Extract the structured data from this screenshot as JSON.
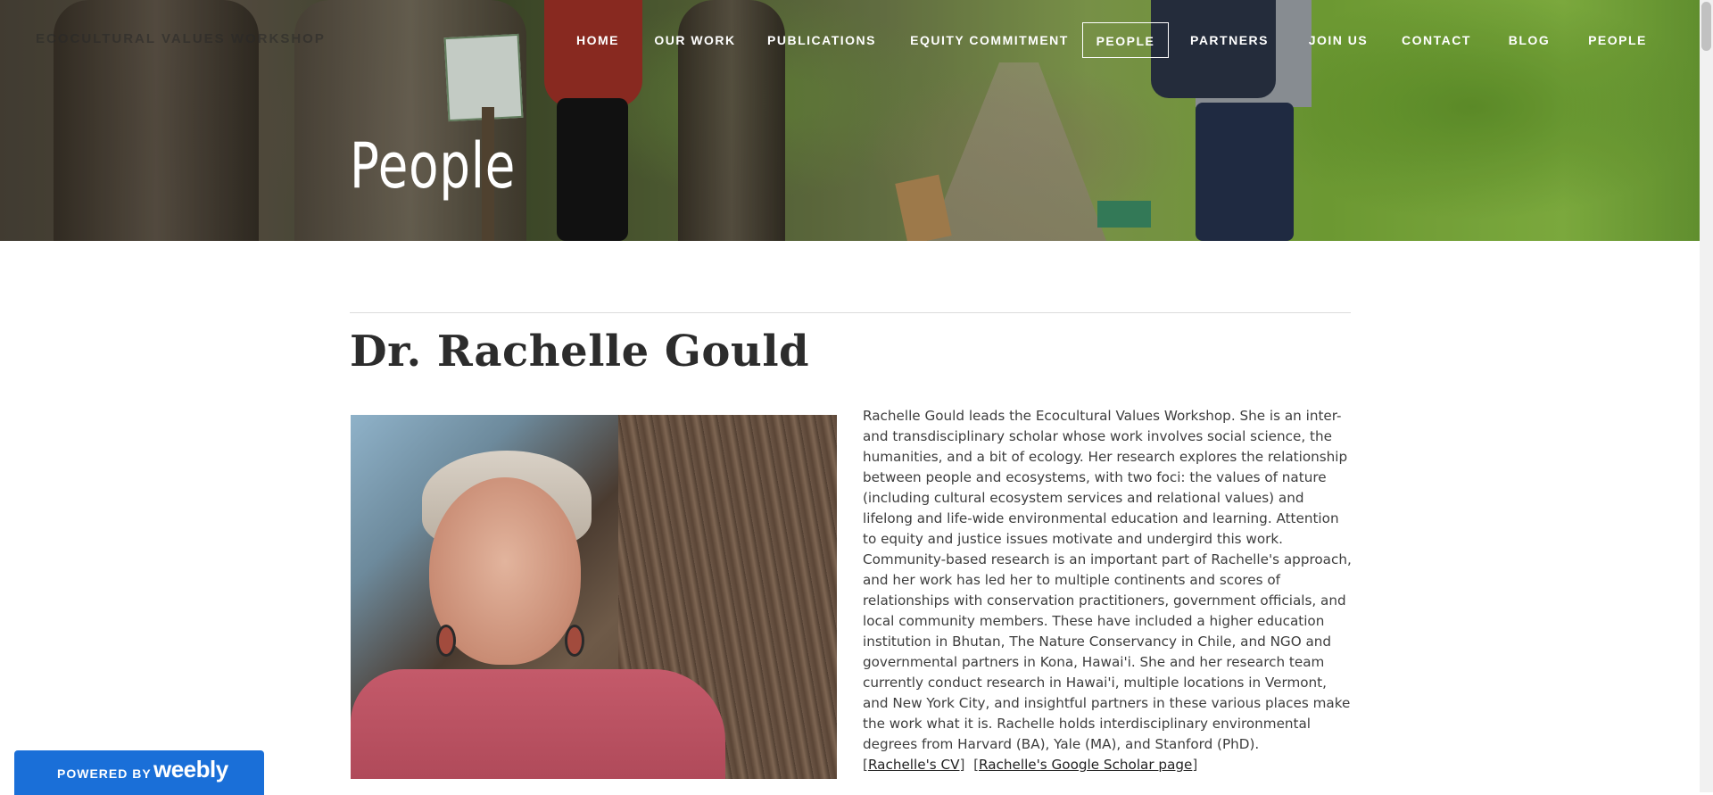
{
  "site": {
    "title": "ECOCULTURAL VALUES WORKSHOP"
  },
  "nav": {
    "items": [
      {
        "label": "HOME"
      },
      {
        "label": "OUR WORK"
      },
      {
        "label": "PUBLICATIONS"
      },
      {
        "label": "EQUITY COMMITMENT"
      },
      {
        "label": "PEOPLE",
        "active": true
      },
      {
        "label": "PARTNERS"
      },
      {
        "label": "JOIN US"
      },
      {
        "label": "CONTACT"
      },
      {
        "label": "BLOG"
      },
      {
        "label": "PEOPLE"
      }
    ]
  },
  "hero": {
    "title": "People"
  },
  "profile": {
    "name": "Dr. Rachelle Gould",
    "bio": "Rachelle Gould leads the Ecocultural Values Workshop. She is an inter- and transdisciplinary scholar whose work involves social science, the humanities, and a bit of ecology. Her research explores the relationship between people and ecosystems, with two foci: the values of nature (including cultural ecosystem services and relational values) and lifelong and life-wide environmental education and learning. Attention to equity and justice issues motivate and undergird this work. Community-based research is an important part of Rachelle's approach, and her work has led her to multiple continents and scores of relationships with conservation practitioners, government officials, and local community members. These have included a higher education institution in Bhutan, The Nature Conservancy in Chile, and NGO and governmental partners in Kona, Hawai'i. She and her research team currently conduct research in Hawai'i, multiple locations in Vermont, and New York City, and insightful partners in these various places make the work what it is. Rachelle holds interdisciplinary environmental degrees from Harvard (BA), Yale (MA), and Stanford (PhD).",
    "links": {
      "cv": "Rachelle's CV",
      "scholar": "Rachelle's Google Scholar page"
    }
  },
  "badge": {
    "powered_by": "POWERED BY",
    "brand": "weebly"
  }
}
